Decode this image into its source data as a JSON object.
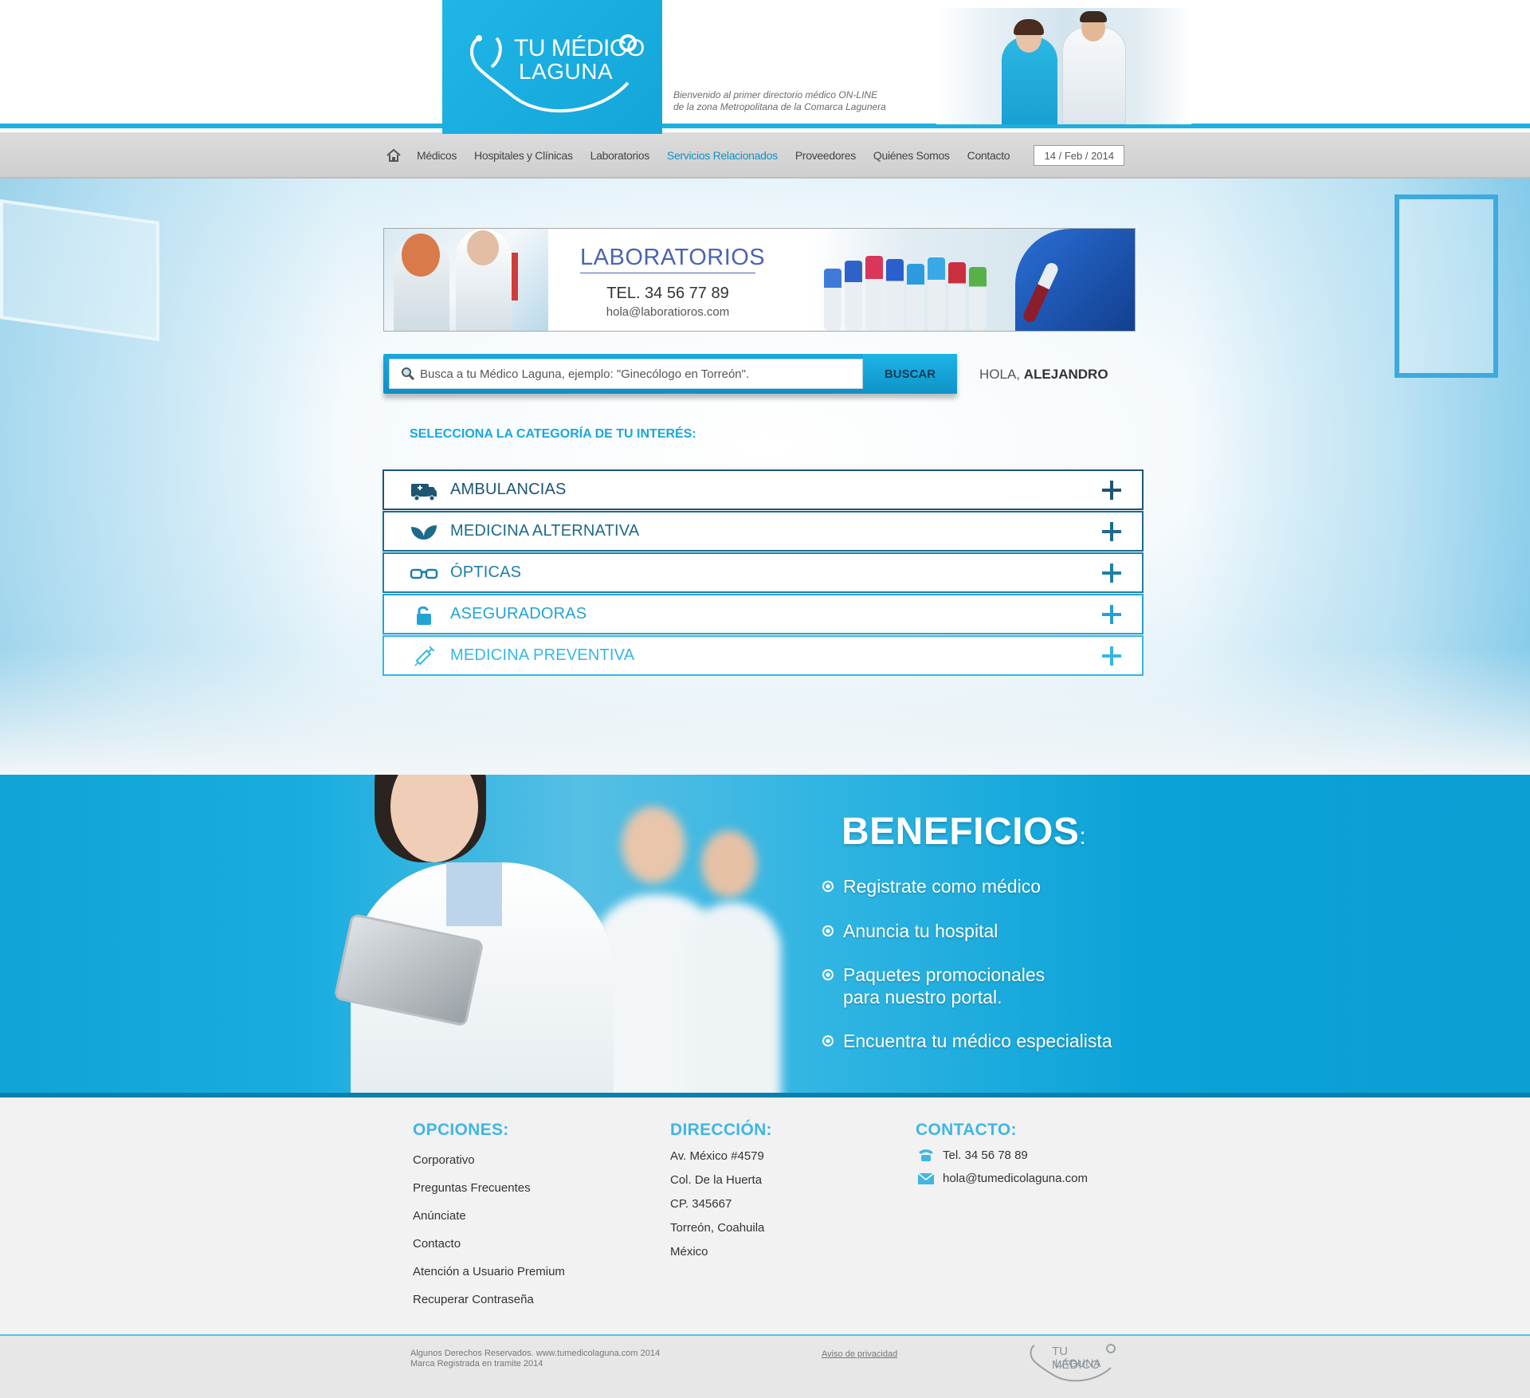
{
  "header": {
    "logo_line1": "TU MÉDICO",
    "logo_line2": "LAGUNA",
    "welcome_line1": "Bienvenido al primer directorio médico ON-LINE",
    "welcome_line2": "de la zona Metropolitana de la Comarca Lagunera"
  },
  "nav": {
    "home_icon": "home-icon",
    "items": [
      "Médicos",
      "Hospitales y Clínicas",
      "Laboratorios",
      "Servicios Relacionados",
      "Proveedores",
      "Quiénes Somos",
      "Contacto"
    ],
    "active_index": 3,
    "date": "14 / Feb / 2014"
  },
  "banner": {
    "title": "LABORATORIOS",
    "tel": "TEL. 34 56 77 89",
    "email": "hola@laboratioros.com"
  },
  "search": {
    "placeholder": "Busca a tu Médico Laguna, ejemplo: \"Ginecólogo en Torreón\".",
    "button": "BUSCAR",
    "greeting_prefix": "HOLA,",
    "greeting_name": "ALEJANDRO"
  },
  "categories": {
    "title": "SELECCIONA LA CATEGORÍA DE TU INTERÉS:",
    "items": [
      {
        "label": "AMBULANCIAS",
        "icon": "ambulance-icon"
      },
      {
        "label": "MEDICINA ALTERNATIVA",
        "icon": "leaf-icon"
      },
      {
        "label": "ÓPTICAS",
        "icon": "glasses-icon"
      },
      {
        "label": "ASEGURADORAS",
        "icon": "lock-icon"
      },
      {
        "label": "MEDICINA PREVENTIVA",
        "icon": "syringe-icon"
      }
    ],
    "colors": [
      "#1d5573",
      "#1d6a8a",
      "#1f7fa6",
      "#23a2d3",
      "#34b7e8"
    ]
  },
  "benefits": {
    "title": "BENEFICIOS",
    "colon": ":",
    "items": [
      {
        "line1": "Registrate como médico",
        "line2": ""
      },
      {
        "line1": "Anuncia tu hospital",
        "line2": ""
      },
      {
        "line1": "Paquetes promocionales",
        "line2": "para nuestro portal."
      },
      {
        "line1": "Encuentra tu médico especialista",
        "line2": ""
      }
    ]
  },
  "footer": {
    "options": {
      "title": "OPCIONES:",
      "links": [
        "Corporativo",
        "Preguntas Frecuentes",
        "Anúnciate",
        "Contacto",
        "Atención a Usuario Premium",
        "Recuperar Contraseña"
      ]
    },
    "address": {
      "title": "DIRECCIÓN:",
      "lines": [
        "Av. México #4579",
        "Col. De la Huerta",
        "CP. 345667",
        "Torreón, Coahuila",
        "México"
      ]
    },
    "contact": {
      "title": "CONTACTO:",
      "tel": "Tel. 34 56 78 89",
      "email": "hola@tumedicolaguna.com"
    },
    "copyright_line1": "Algunos Derechos Reservados. www.tumedicolaguna.com 2014",
    "copyright_line2": "Marca Registrada en tramite 2014",
    "privacy": "Aviso de privacidad",
    "logo_line1": "TU MÉDICO",
    "logo_line2": "LAGUNA"
  },
  "colors": {
    "brand_blue": "#1bb0e0",
    "dark_navy": "#1d5573",
    "banner_title": "#4c63b1"
  }
}
